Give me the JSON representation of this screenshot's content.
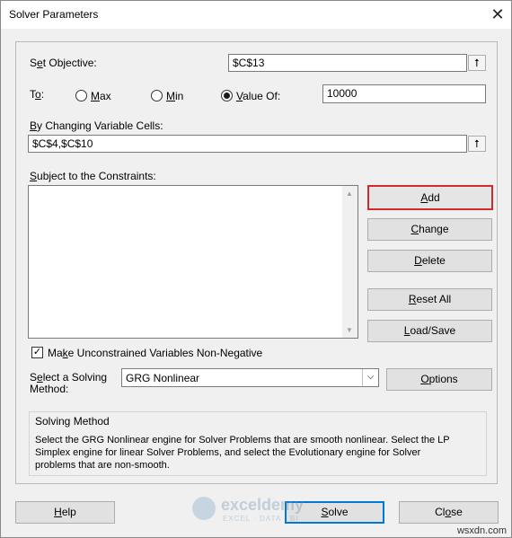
{
  "window": {
    "title": "Solver Parameters",
    "close_glyph": "✕"
  },
  "objective": {
    "label_prefix": "S",
    "label_u": "e",
    "label_rest": "t Objective:",
    "value": "$C$13"
  },
  "to": {
    "label_prefix": "T",
    "label_u": "o",
    "label_rest": ":",
    "max_u": "M",
    "max_rest": "ax",
    "min_u": "M",
    "min_rest": "in",
    "value_u": "V",
    "value_rest": "alue Of:",
    "selected": "value_of",
    "value": "10000"
  },
  "changing_cells": {
    "label_u": "B",
    "label_rest": "y Changing Variable Cells:",
    "value": "$C$4,$C$10"
  },
  "constraints": {
    "label_u": "S",
    "label_rest": "ubject to the Constraints:"
  },
  "buttons": {
    "add_u": "A",
    "add_rest": "dd",
    "change_u": "C",
    "change_rest": "hange",
    "delete_u": "D",
    "delete_rest": "elete",
    "reset_u": "R",
    "reset_rest": "eset All",
    "load_u": "L",
    "load_rest": "oad/Save",
    "options_u": "O",
    "options_rest": "ptions",
    "help_u": "H",
    "help_rest": "elp",
    "solve_u": "S",
    "solve_rest": "olve",
    "close_pre": "Cl",
    "close_u": "o",
    "close_rest": "se"
  },
  "nonneg": {
    "checked": true,
    "label_pre": "Ma",
    "label_u": "k",
    "label_rest": "e Unconstrained Variables Non-Negative"
  },
  "method": {
    "label_line1_pre": "S",
    "label_line1_u": "e",
    "label_line1_rest": "lect a Solving",
    "label_line2": "Method:",
    "selected": "GRG Nonlinear"
  },
  "solving_method": {
    "heading": "Solving Method",
    "line1": "Select the GRG Nonlinear engine for Solver Problems that are smooth nonlinear. Select the LP",
    "line2": "Simplex engine for linear Solver Problems, and select the Evolutionary engine for Solver",
    "line3": "problems that are non-smooth."
  },
  "watermark": {
    "brand": "exceldemy",
    "sub": "EXCEL · DATA · BI"
  },
  "corner_text": "wsxdn.com",
  "icons": {
    "ref": "collapse-dialog-icon",
    "dropdown": "chevron-down-icon"
  }
}
